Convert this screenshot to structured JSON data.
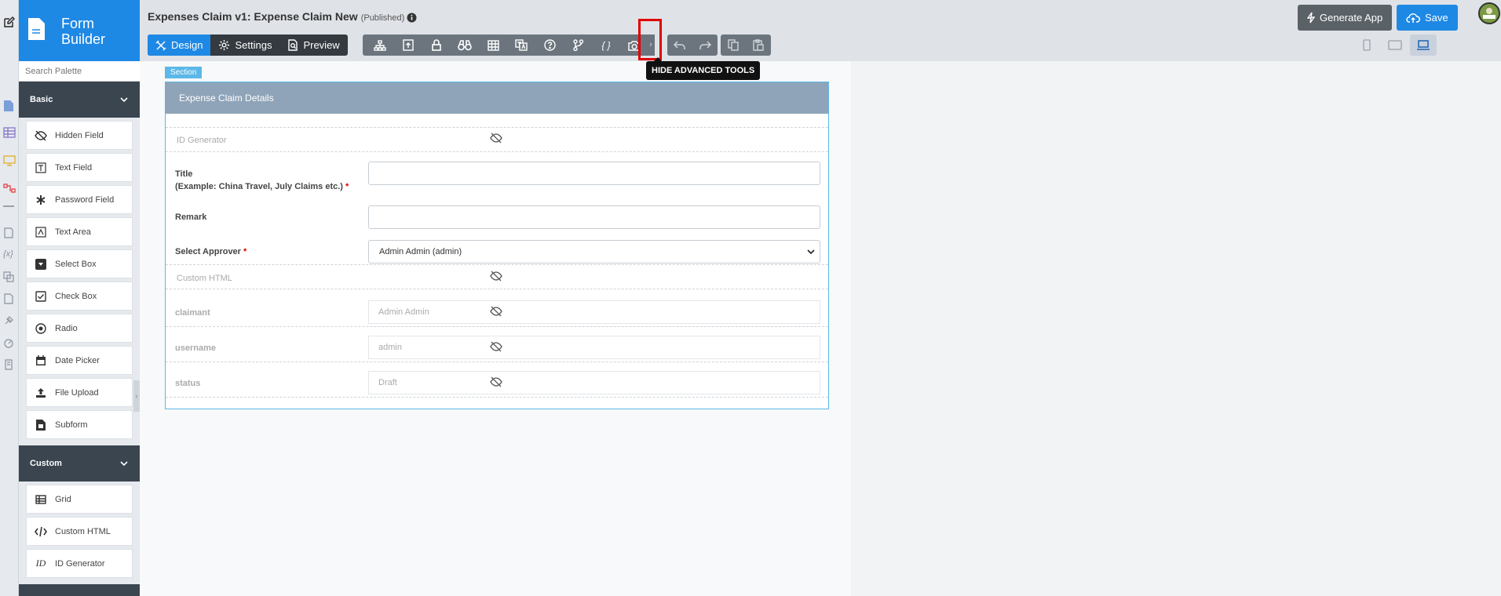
{
  "brand": {
    "title_line1": "Form",
    "title_line2": "Builder",
    "color": "#1e88e5"
  },
  "palette": {
    "search_placeholder": "Search Palette",
    "categories": [
      {
        "label": "Basic",
        "items": [
          "Hidden Field",
          "Text Field",
          "Password Field",
          "Text Area",
          "Select Box",
          "Check Box",
          "Radio",
          "Date Picker",
          "File Upload",
          "Subform"
        ]
      },
      {
        "label": "Custom",
        "items": [
          "Grid",
          "Custom HTML",
          "ID Generator"
        ]
      }
    ]
  },
  "header": {
    "title": "Expenses Claim v1: Expense Claim New",
    "status": "(Published)",
    "modes": {
      "design": "Design",
      "settings": "Settings",
      "preview": "Preview"
    },
    "tooltip": "HIDE ADVANCED TOOLS",
    "generate_app": "Generate App",
    "save": "Save"
  },
  "section": {
    "tag": "Section",
    "title": "Expense Claim Details",
    "fields": {
      "id_generator": {
        "label": "ID Generator"
      },
      "title": {
        "label_line1": "Title",
        "label_line2": "(Example: China Travel, July Claims etc.)",
        "value": ""
      },
      "remark": {
        "label": "Remark",
        "value": ""
      },
      "approver": {
        "label": "Select Approver",
        "value": "Admin Admin (admin)"
      },
      "custom_html": {
        "label": "Custom HTML"
      },
      "claimant": {
        "label": "claimant",
        "value": "Admin Admin"
      },
      "username": {
        "label": "username",
        "value": "admin"
      },
      "status": {
        "label": "status",
        "value": "Draft"
      }
    }
  },
  "colors": {
    "accent": "#1e88e5",
    "dark": "#3a4550",
    "required": "#dd0000",
    "highlight": "#e00000"
  }
}
